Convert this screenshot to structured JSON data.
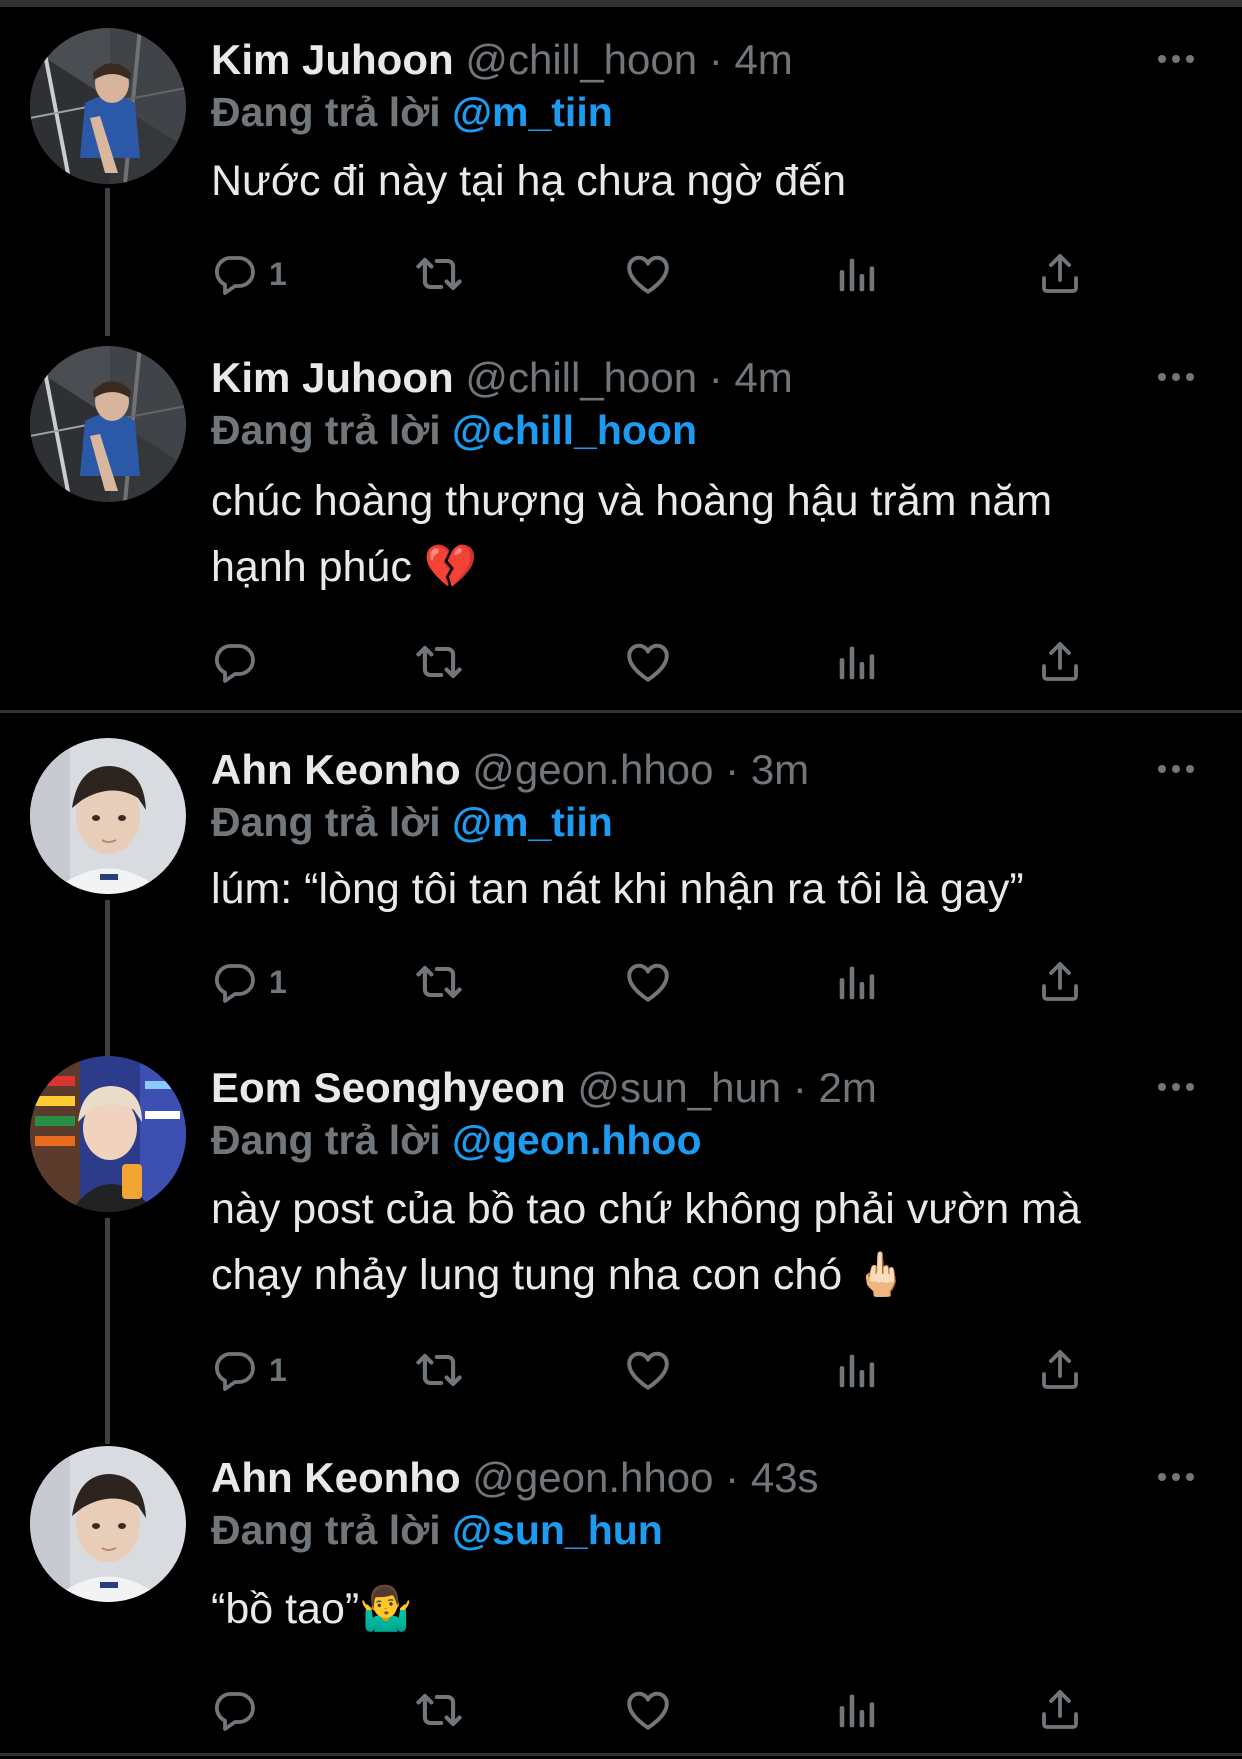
{
  "reply_prefix": "Đang trả lời",
  "tweets": [
    {
      "name": "Kim Juhoon",
      "handle": "@chill_hoon",
      "separator": "·",
      "time": "4m",
      "reply_to": "@m_tiin",
      "text": "Nước đi này tại hạ chưa ngờ đến",
      "reply_count": "1",
      "avatar": "selfie-blue-shirt"
    },
    {
      "name": "Kim Juhoon",
      "handle": "@chill_hoon",
      "separator": "·",
      "time": "4m",
      "reply_to": "@chill_hoon",
      "text_line1": "chúc hoàng thượng và hoàng hậu trăm năm",
      "text_line2": "hạnh phúc 💔",
      "reply_count": "",
      "avatar": "selfie-blue-shirt"
    },
    {
      "name": "Ahn Keonho",
      "handle": "@geon.hhoo",
      "separator": "·",
      "time": "3m",
      "reply_to": "@m_tiin",
      "text": "lúm: “lòng tôi tan nát khi nhận ra tôi là gay”",
      "reply_count": "1",
      "avatar": "selfie-white-shirt"
    },
    {
      "name": "Eom Seonghyeon",
      "handle": "@sun_hun",
      "separator": "·",
      "time": "2m",
      "reply_to": "@geon.hhoo",
      "text_line1": "này post của bồ tao chứ không phải vườn mà",
      "text_line2": "chạy nhảy lung tung nha con chó 🖕🏻",
      "reply_count": "1",
      "avatar": "selfie-store"
    },
    {
      "name": "Ahn Keonho",
      "handle": "@geon.hhoo",
      "separator": "·",
      "time": "43s",
      "reply_to": "@sun_hun",
      "text": "“bồ tao”🤷‍♂️",
      "reply_count": "",
      "avatar": "selfie-white-shirt"
    }
  ],
  "icons": [
    "reply-icon",
    "retweet-icon",
    "like-icon",
    "views-icon",
    "share-icon",
    "more-icon"
  ],
  "colors": {
    "background": "#000000",
    "text": "#e7e9ea",
    "muted": "#71767b",
    "mention": "#1d9bf0",
    "line": "#2f3336"
  }
}
